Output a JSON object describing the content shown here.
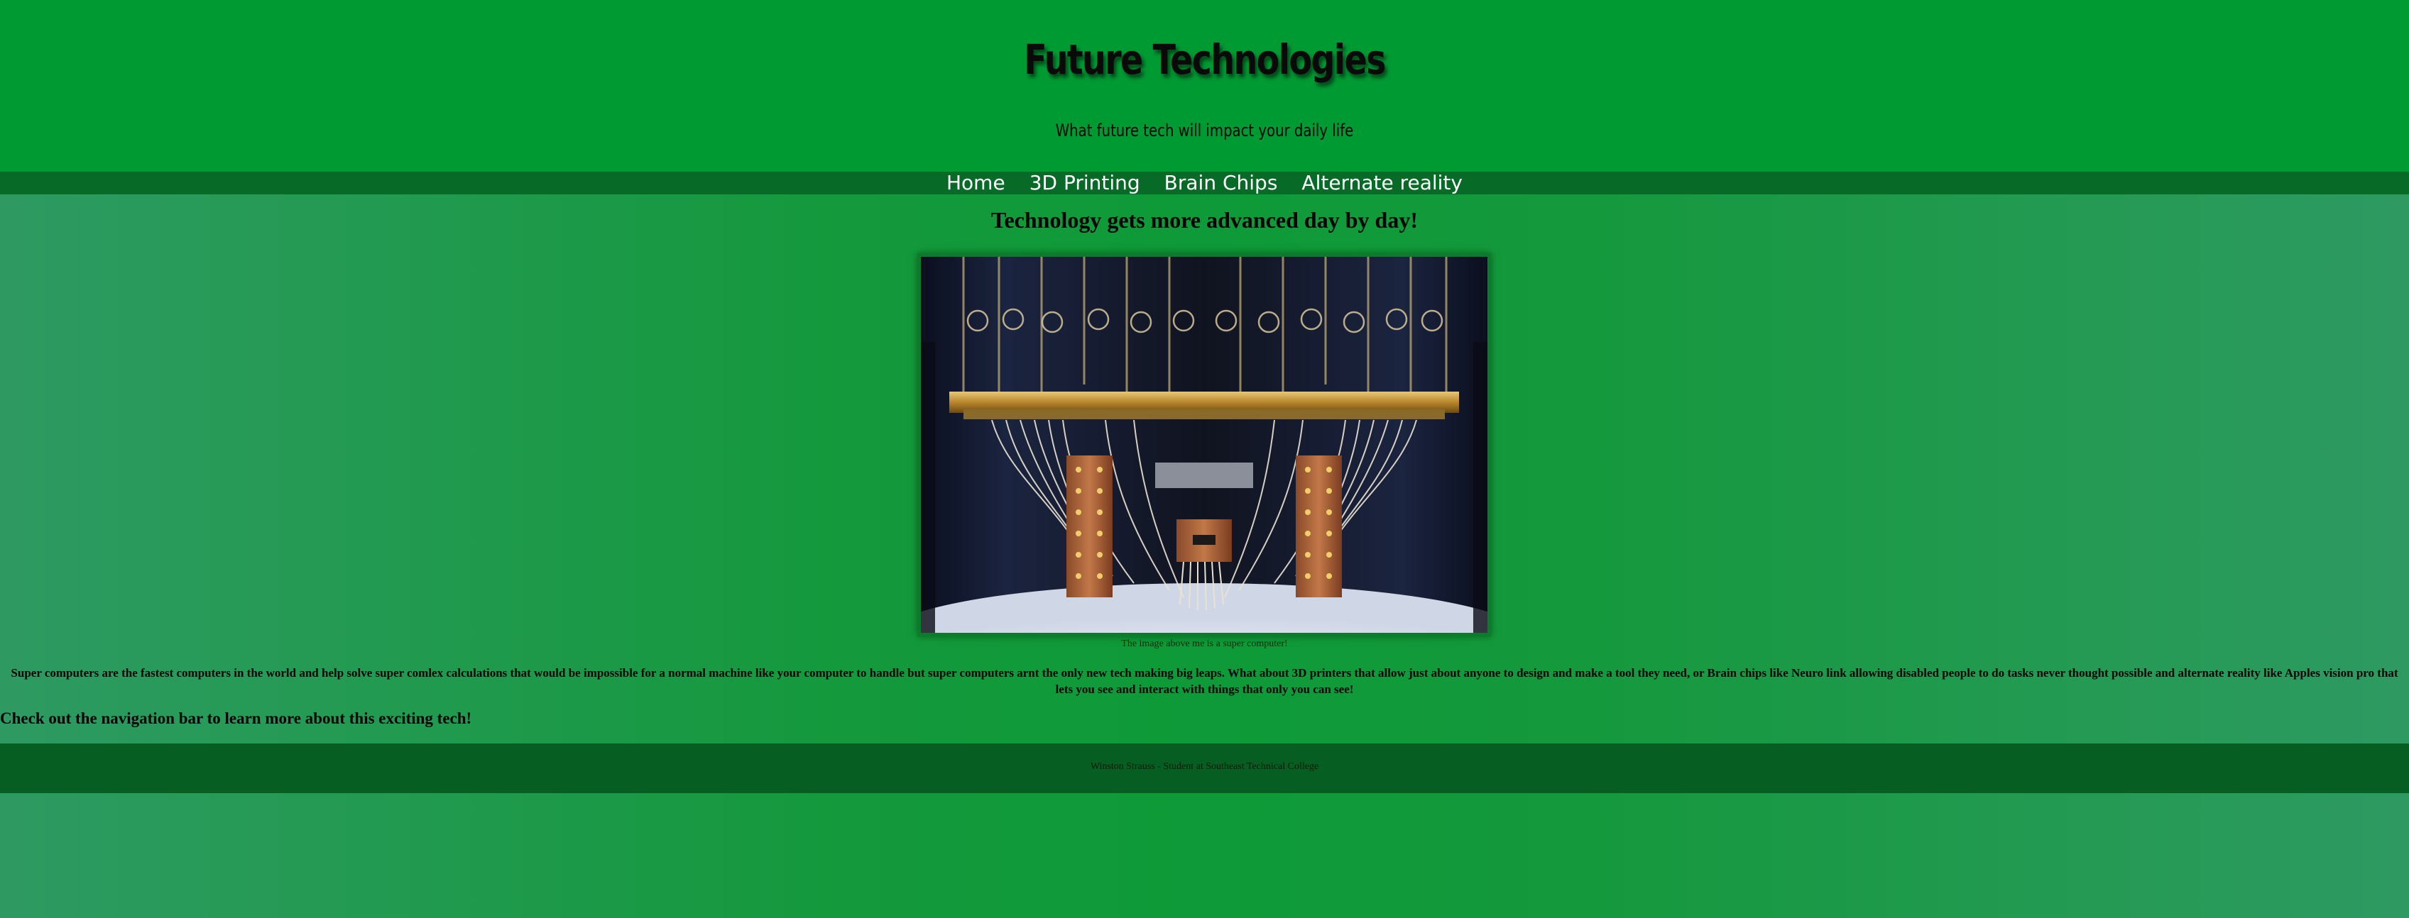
{
  "header": {
    "title": "Future Technologies",
    "subtitle": "What future tech will impact your daily life"
  },
  "nav": {
    "items": [
      {
        "label": "Home"
      },
      {
        "label": "3D Printing"
      },
      {
        "label": "Brain Chips"
      },
      {
        "label": "Alternate reality"
      }
    ]
  },
  "main": {
    "heading": "Technology gets more advanced day by day!",
    "image_caption": "The image above me is a super computer!",
    "body": "Super computers are the fastest computers in the world and help solve super comlex calculations that would be impossible for a normal machine like your computer to handle but super computers arnt the only new tech making big leaps. What about 3D printers that allow just about anyone to design and make a tool they need, or Brain chips like Neuro link allowing disabled people to do tasks never thought possible and alternate reality like Apples vision pro that lets you see and interact with things that only you can see!",
    "cta": "Check out the navigation bar to learn more about this exciting tech!"
  },
  "footer": {
    "text": "Winston Strauss - Student at Southeast Technical College"
  },
  "colors": {
    "header_bg": "#009a33",
    "nav_bg": "#076b27",
    "footer_bg": "#075e22",
    "frame_border": "#0e7a2e"
  }
}
